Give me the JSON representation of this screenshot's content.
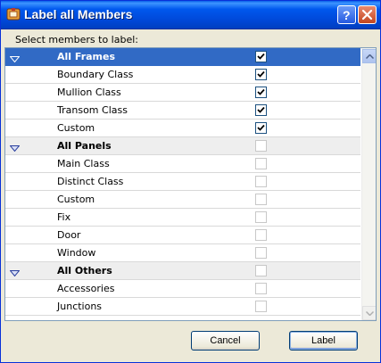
{
  "window": {
    "title": "Label all Members",
    "icons": {
      "app": "archicad-app-icon",
      "help": "help-icon",
      "close": "close-icon"
    }
  },
  "instruction": "Select members to label:",
  "list": {
    "rows": [
      {
        "label": "All Frames",
        "group": true,
        "checked": true,
        "selected": true
      },
      {
        "label": "Boundary Class",
        "group": false,
        "checked": true
      },
      {
        "label": "Mullion Class",
        "group": false,
        "checked": true
      },
      {
        "label": "Transom Class",
        "group": false,
        "checked": true
      },
      {
        "label": "Custom",
        "group": false,
        "checked": true
      },
      {
        "label": "All Panels",
        "group": true,
        "checked": false
      },
      {
        "label": "Main Class",
        "group": false,
        "checked": false
      },
      {
        "label": "Distinct Class",
        "group": false,
        "checked": false
      },
      {
        "label": "Custom",
        "group": false,
        "checked": false
      },
      {
        "label": "Fix",
        "group": false,
        "checked": false
      },
      {
        "label": "Door",
        "group": false,
        "checked": false
      },
      {
        "label": "Window",
        "group": false,
        "checked": false
      },
      {
        "label": "All Others",
        "group": true,
        "checked": false
      },
      {
        "label": "Accessories",
        "group": false,
        "checked": false
      },
      {
        "label": "Junctions",
        "group": false,
        "checked": false
      }
    ]
  },
  "buttons": {
    "cancel": "Cancel",
    "label": "Label"
  },
  "colors": {
    "selection": "#316ac5",
    "title_bar": "#0058ee",
    "dialog_bg": "#ece9d8"
  }
}
